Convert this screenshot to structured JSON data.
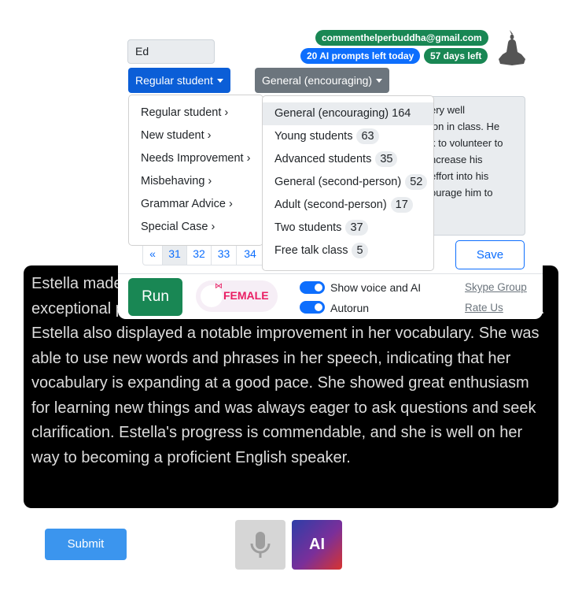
{
  "output_text": "Estella made great progress in her English lessons. She showed exceptional pronunciation and her listening skills were equally impressive. Estella also displayed a notable improvement in her vocabulary. She was able to use new words and phrases in her speech, indicating that her vocabulary is expanding at a good pace. She showed great enthusiasm for learning new things and was always eager to ask questions and seek clarification. Estella's progress is commendable, and she is well on her way to becoming a proficient English speaker.",
  "student_name": "Ed",
  "badges": {
    "email": "commenthelperbuddha@gmail.com",
    "prompts": "20 AI prompts left today",
    "days": "57 days left"
  },
  "colors": {
    "green": "#198754",
    "blue": "#0d6efd",
    "dark_blue": "#0b5ed7",
    "gray": "#6c757d"
  },
  "category_button": "Regular student",
  "style_button": "General (encouraging)",
  "category_menu": [
    "Regular student ›",
    "New student ›",
    "Needs Improvement ›",
    "Misbehaving ›",
    "Grammar Advice ›",
    "Special Case ›"
  ],
  "style_menu": [
    {
      "label": "General (encouraging)",
      "count": "164"
    },
    {
      "label": "Young students",
      "count": "63"
    },
    {
      "label": "Advanced students",
      "count": "35"
    },
    {
      "label": "General (second-person)",
      "count": "52"
    },
    {
      "label": "Adult (second-person)",
      "count": "17"
    },
    {
      "label": "Two students",
      "count": "37"
    },
    {
      "label": "Free talk class",
      "count": "5"
    }
  ],
  "comment_fragments": [
    "ery well",
    "ion in class. He",
    "k to volunteer to",
    "ncrease his",
    "effort into his",
    "ourage him to"
  ],
  "pagination": [
    "«",
    "31",
    "32",
    "33",
    "34"
  ],
  "save": "Save",
  "run": "Run",
  "gender": "FEMALE",
  "toggles": {
    "voice": "Show voice and AI",
    "autorun": "Autorun"
  },
  "links": {
    "skype": "Skype Group",
    "rate": "Rate Us"
  },
  "submit": "Submit",
  "ai": "AI"
}
